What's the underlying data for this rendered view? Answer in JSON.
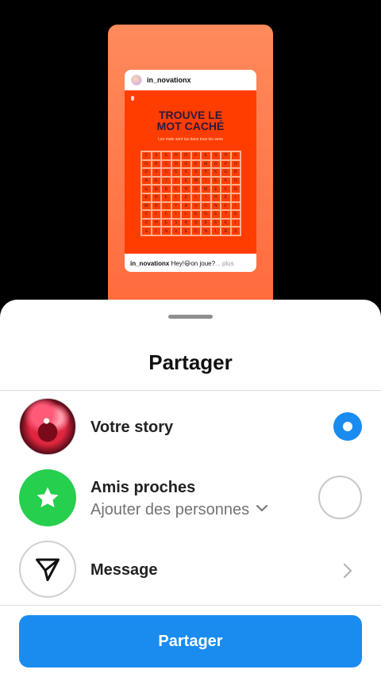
{
  "story_preview": {
    "username": "in_novationx",
    "post_title": "TROUVE LE\nMOT CACHÉ",
    "post_subtitle": "Les mots sont lus dans tous les sens",
    "grid_letters": [
      [
        "C",
        "S",
        "E",
        "H",
        "O",
        "F",
        "E",
        "S",
        "H",
        "C"
      ],
      [
        "O",
        "R",
        "C",
        "O",
        "G",
        "K",
        "M",
        "G",
        "P",
        "O"
      ],
      [
        "D",
        "V",
        "C",
        "G",
        "K",
        "S",
        "P",
        "K",
        "G",
        "B"
      ],
      [
        "A",
        "E",
        "I",
        "I",
        "E",
        "W",
        "I",
        "E",
        "K",
        "O"
      ],
      [
        "G",
        "N",
        "R",
        "C",
        "H",
        "O",
        "M",
        "E",
        "F",
        "N"
      ],
      [
        "E",
        "N",
        "E",
        "I",
        "E",
        "I",
        "I",
        "H",
        "E",
        "I"
      ],
      [
        "M",
        "O",
        "I",
        "T",
        "A",
        "V",
        "C",
        "N",
        "F",
        "I"
      ],
      [
        "C",
        "I",
        "F",
        "I",
        "L",
        "E",
        "G",
        "E",
        "T",
        "E"
      ],
      [
        "U",
        "H",
        "E",
        "S",
        "B",
        "S",
        "E",
        "E",
        "E",
        "I"
      ],
      [
        "S",
        "I",
        "N",
        "V",
        "E",
        "C",
        "N",
        "I",
        "R",
        "S"
      ]
    ],
    "caption_user": "in_novationx",
    "caption_text": " Hey!😃on joue?",
    "caption_more": "... plus"
  },
  "sheet": {
    "title": "Partager",
    "options": [
      {
        "title": "Votre story",
        "selected": true
      },
      {
        "title": "Amis proches",
        "subtitle": "Ajouter des personnes",
        "selected": false
      },
      {
        "title": "Message"
      }
    ],
    "share_button": "Partager"
  },
  "colors": {
    "accent": "#1a8cf0",
    "close_friends": "#26cf4d",
    "story_bg": "#ff3d00"
  }
}
